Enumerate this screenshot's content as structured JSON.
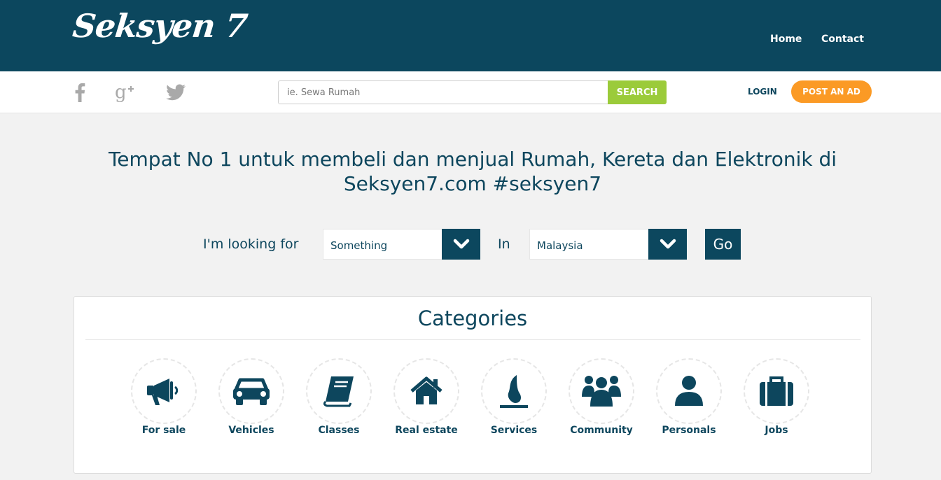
{
  "header": {
    "logo": "Seksyen 7",
    "nav": [
      {
        "label": "Home"
      },
      {
        "label": "Contact"
      }
    ]
  },
  "subbar": {
    "social_icons": [
      "facebook-icon",
      "google-plus-icon",
      "twitter-icon"
    ],
    "search": {
      "placeholder": "ie. Sewa Rumah",
      "value": "",
      "button_label": "SEARCH"
    },
    "login_label": "LOGIN",
    "post_ad_label": "POST AN AD"
  },
  "hero": {
    "headline": "Tempat No 1 untuk membeli dan menjual Rumah, Kereta dan Elektronik di Seksyen7.com #seksyen7"
  },
  "finder": {
    "looking_label": "I'm looking for",
    "what_value": "Something",
    "in_label": "In",
    "where_value": "Malaysia",
    "go_label": "Go"
  },
  "categories": {
    "title": "Categories",
    "items": [
      {
        "label": "For sale",
        "icon": "megaphone-icon"
      },
      {
        "label": "Vehicles",
        "icon": "car-icon"
      },
      {
        "label": "Classes",
        "icon": "book-icon"
      },
      {
        "label": "Real estate",
        "icon": "house-icon"
      },
      {
        "label": "Services",
        "icon": "flame-icon"
      },
      {
        "label": "Community",
        "icon": "group-icon"
      },
      {
        "label": "Personals",
        "icon": "person-icon"
      },
      {
        "label": "Jobs",
        "icon": "briefcase-icon"
      }
    ]
  },
  "colors": {
    "primary": "#0c475e",
    "search_button": "#9bcb3a",
    "post_ad_button": "#fb9a25",
    "background": "#f2f2f2"
  }
}
